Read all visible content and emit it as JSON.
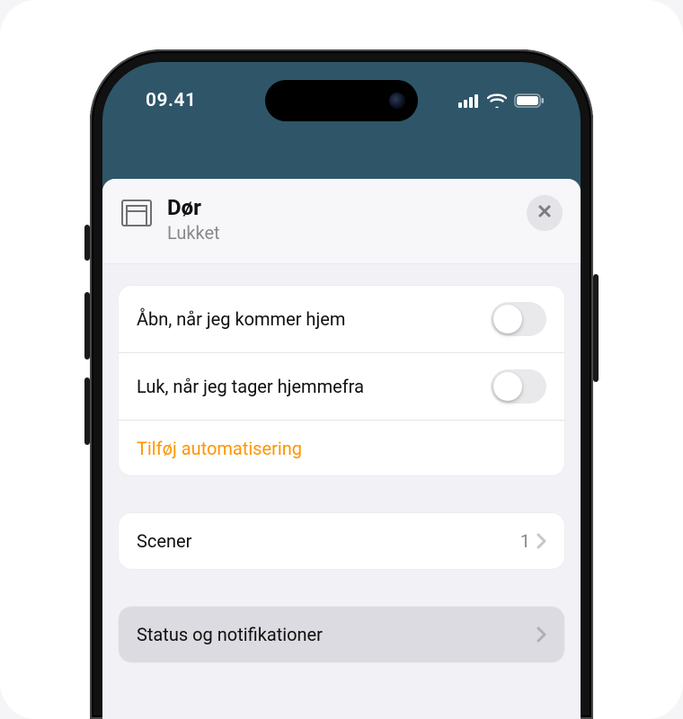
{
  "statusbar": {
    "time": "09.41"
  },
  "header": {
    "title": "Dør",
    "subtitle": "Lukket"
  },
  "automations": {
    "rows": [
      {
        "label": "Åbn, når jeg kommer hjem",
        "on": false
      },
      {
        "label": "Luk, når jeg tager hjemmefra",
        "on": false
      }
    ],
    "add_label": "Tilføj automatisering"
  },
  "scenes": {
    "label": "Scener",
    "count": "1"
  },
  "status_notifications": {
    "label": "Status og notifikationer"
  }
}
